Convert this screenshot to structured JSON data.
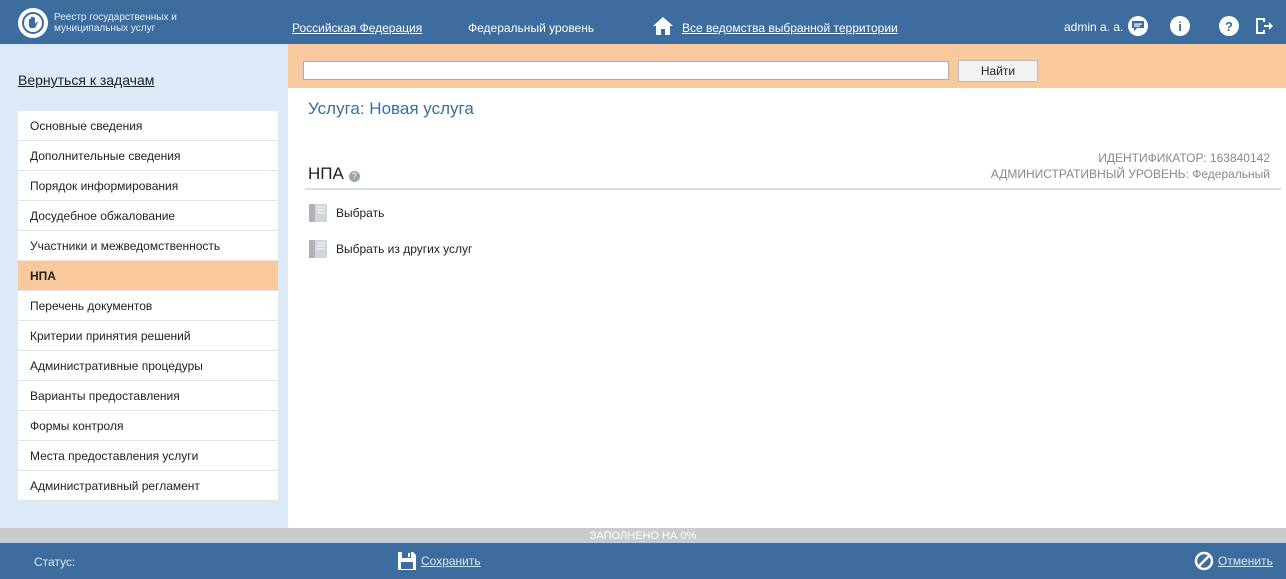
{
  "header": {
    "logo_text": "Реестр государственных и муниципальных услуг",
    "nav_country": "Российская Федерация",
    "nav_level": "Федеральный уровень",
    "nav_agencies": "Все ведомства выбранной территории",
    "user": "admin a. a.",
    "icons": [
      "chat-icon",
      "info-icon",
      "help-icon",
      "logout-icon"
    ]
  },
  "sidebar": {
    "back_link": "Вернуться к задачам",
    "items": [
      {
        "label": "Основные сведения",
        "active": false
      },
      {
        "label": "Дополнительные сведения",
        "active": false
      },
      {
        "label": "Порядок информирования",
        "active": false
      },
      {
        "label": "Досудебное обжалование",
        "active": false
      },
      {
        "label": "Участники и межведомственность",
        "active": false
      },
      {
        "label": "НПА",
        "active": true
      },
      {
        "label": "Перечень документов",
        "active": false
      },
      {
        "label": "Критерии принятия решений",
        "active": false
      },
      {
        "label": "Административные процедуры",
        "active": false
      },
      {
        "label": "Варианты предоставления",
        "active": false
      },
      {
        "label": "Формы контроля",
        "active": false
      },
      {
        "label": "Места предоставления услуги",
        "active": false
      },
      {
        "label": "Административный регламент",
        "active": false
      }
    ]
  },
  "search": {
    "value": "",
    "placeholder": "",
    "button": "Найти"
  },
  "main": {
    "title": "Услуга: Новая услуга",
    "section_title": "НПА",
    "id_label": "ИДЕНТИФИКАТОР:",
    "id_value": "163840142",
    "level_label": "АДМИНИСТРАТИВНЫЙ УРОВЕНЬ:",
    "level_value": "Федеральный",
    "actions": [
      {
        "label": "Выбрать"
      },
      {
        "label": "Выбрать из других услуг"
      }
    ]
  },
  "progress": {
    "text": "ЗАПОЛНЕНО НА 0%",
    "percent": 0
  },
  "footer": {
    "status_label": "Статус:",
    "save": "Сохранить",
    "cancel": "Отменить"
  },
  "colors": {
    "brand": "#3c6d9e",
    "accent": "#f9c99e",
    "sidebar_bg": "#dce9f6"
  }
}
